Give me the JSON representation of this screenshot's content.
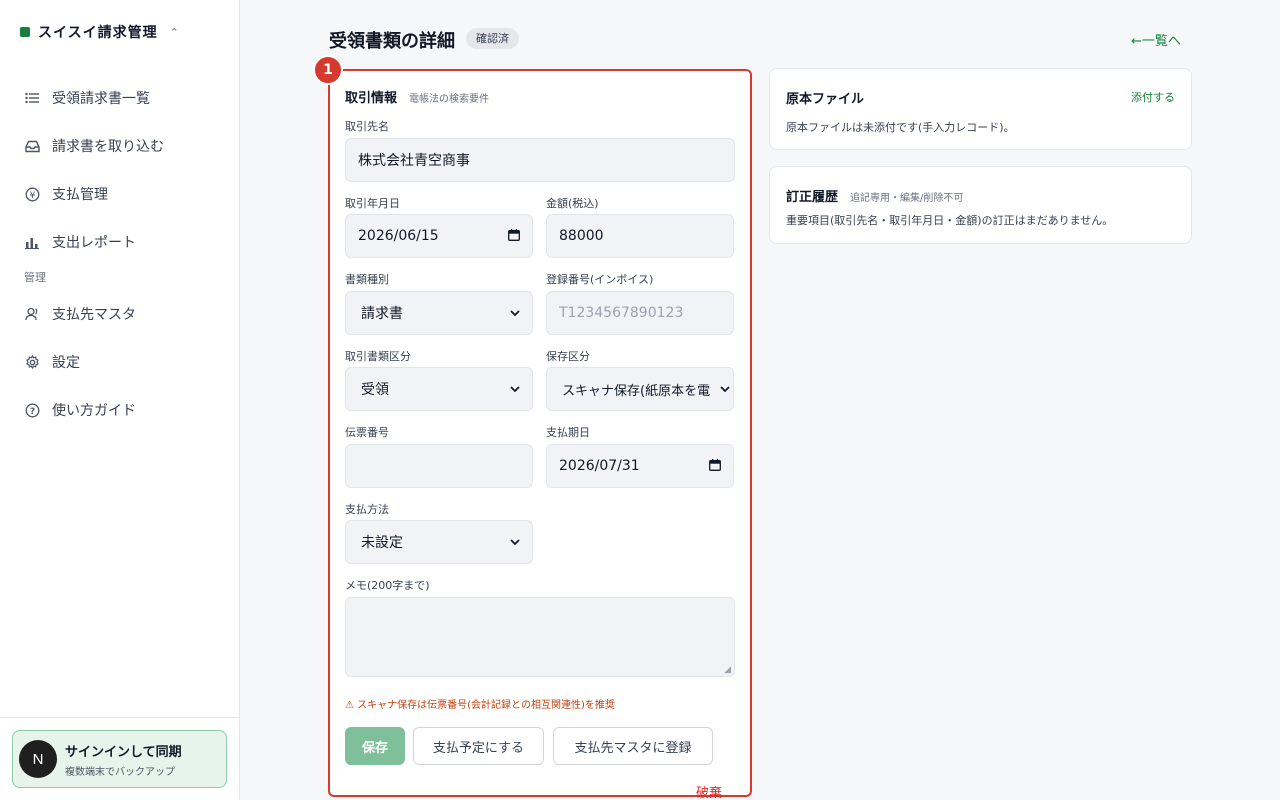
{
  "sidebar": {
    "brand": "スイスイ請求管理",
    "items": [
      {
        "label": "受領請求書一覧",
        "icon": "list-icon"
      },
      {
        "label": "請求書を取り込む",
        "icon": "inbox-icon"
      },
      {
        "label": "支払管理",
        "icon": "yen-icon"
      },
      {
        "label": "支出レポート",
        "icon": "bar-chart-icon"
      }
    ],
    "section": "管理",
    "admin_items": [
      {
        "label": "支払先マスタ",
        "icon": "user-icon"
      },
      {
        "label": "設定",
        "icon": "gear-icon"
      },
      {
        "label": "使い方ガイド",
        "icon": "help-icon"
      }
    ],
    "signin": {
      "avatar": "N",
      "title": "サインインして同期",
      "subtitle": "複数端末でバックアップ"
    }
  },
  "header": {
    "title": "受領書類の詳細",
    "status": "確認済",
    "back_link": "←一覧へ"
  },
  "form": {
    "marker": "1",
    "title": "取引情報",
    "subtitle": "電帳法の検索要件",
    "partner_label": "取引先名",
    "partner_value": "株式会社青空商事",
    "date_label": "取引年月日",
    "date_value": "2026/06/15",
    "amount_label": "金額(税込)",
    "amount_value": "88000",
    "doc_type_label": "書類種別",
    "doc_type_value": "請求書",
    "reg_label": "登録番号(インボイス)",
    "reg_placeholder": "T1234567890123",
    "category_label": "取引書類区分",
    "category_value": "受領",
    "storage_label": "保存区分",
    "storage_value": "スキャナ保存(紙原本を電",
    "voucher_label": "伝票番号",
    "voucher_value": "",
    "due_label": "支払期日",
    "due_value": "2026/07/31",
    "method_label": "支払方法",
    "method_value": "未設定",
    "memo_label": "メモ(200字まで)",
    "warning": "⚠ スキャナ保存は伝票番号(会計記録との相互関連性)を推奨",
    "save": "保存",
    "schedule": "支払予定にする",
    "register": "支払先マスタに登録",
    "discard": "破棄"
  },
  "original_file": {
    "title": "原本ファイル",
    "attach": "添付する",
    "text": "原本ファイルは未添付です(手入力レコード)。"
  },
  "history": {
    "title": "訂正履歴",
    "subtitle": "追記専用・編集/削除不可",
    "text": "重要項目(取引先名・取引年月日・金額)の訂正はまだありません。"
  }
}
